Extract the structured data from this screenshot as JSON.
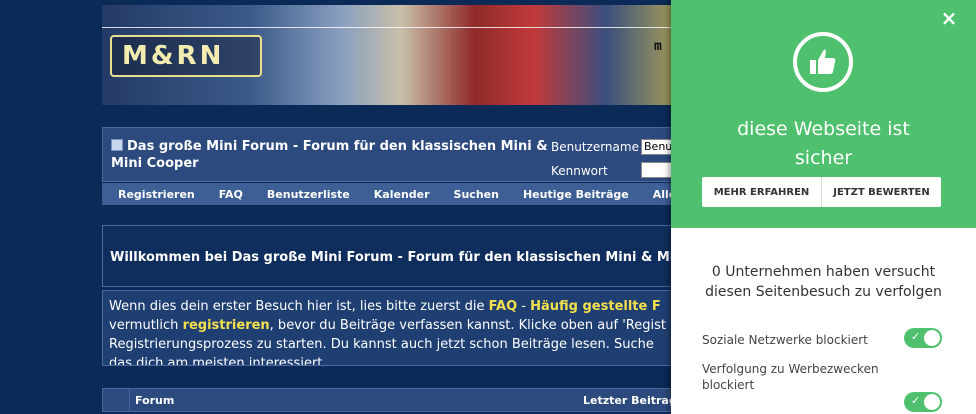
{
  "banner": {
    "logo_text": "M&RN",
    "site_text": "m"
  },
  "header": {
    "title": "Das große Mini Forum - Forum für den klassischen Mini & Mini Cooper",
    "username_label": "Benutzername",
    "username_value": "Benut",
    "password_label": "Kennwort"
  },
  "navbar": {
    "items": [
      "Registrieren",
      "FAQ",
      "Benutzerliste",
      "Kalender",
      "Suchen",
      "Heutige Beiträge",
      "Alle"
    ]
  },
  "welcome": {
    "title": "Willkommen bei Das große Mini Forum - Forum für den klassischen Mini & Mini",
    "line1_a": "Wenn dies dein erster Besuch hier ist, lies bitte zuerst die ",
    "faq": "FAQ",
    "line1_b": " - ",
    "faq_long": "Häufig gestellte F",
    "line2_a": "vermutlich ",
    "register": "registrieren",
    "line2_b": ", bevor du Beiträge verfassen kannst. Klicke oben auf 'Regist",
    "line3": "Registrierungsprozess zu starten. Du kannst auch jetzt schon Beiträge lesen. Suche",
    "line4": "das dich am meisten interessiert."
  },
  "table": {
    "col_forum": "Forum",
    "col_last": "Letzter Beitrag"
  },
  "panel": {
    "close_glyph": "×",
    "headline_line1": "diese Webseite ist",
    "headline_line2": "sicher",
    "btn_learn": "MEHR ERFAHREN",
    "btn_rate": "JETZT BEWERTEN",
    "tracked_line1": "0 Unternehmen haben versucht",
    "tracked_line2": "diesen Seitenbesuch zu verfolgen",
    "toggles": [
      {
        "label": "Soziale Netzwerke blockiert",
        "on": true
      },
      {
        "label": "Verfolgung zu Werbezwecken blockiert",
        "on": true
      }
    ],
    "check_glyph": "✓",
    "accent": "#4ec06e"
  }
}
